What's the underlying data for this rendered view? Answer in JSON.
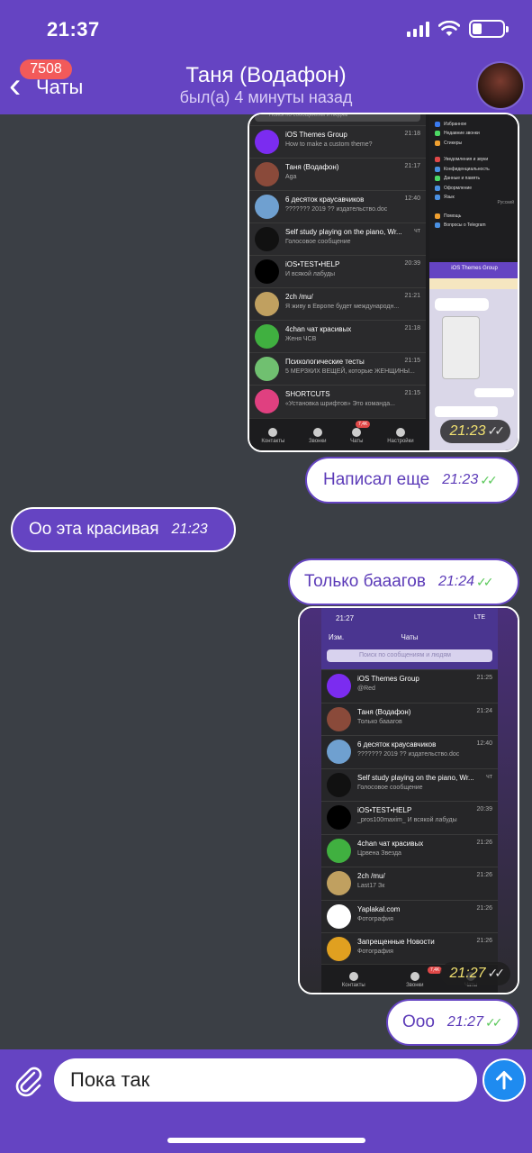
{
  "status_bar": {
    "time": "21:37"
  },
  "header": {
    "back_label": "Чаты",
    "unread_badge": "7508",
    "contact_name": "Таня (Водафон)",
    "last_seen": "был(а) 4 минуты назад"
  },
  "messages": [
    {
      "id": "m1",
      "direction": "out",
      "type": "image",
      "time": "21:23",
      "read": true
    },
    {
      "id": "m2",
      "direction": "out",
      "type": "text",
      "text": "Написал еще",
      "time": "21:23",
      "read": true
    },
    {
      "id": "m3",
      "direction": "in",
      "type": "text",
      "text": "Оо эта красивая",
      "time": "21:23"
    },
    {
      "id": "m4",
      "direction": "out",
      "type": "text",
      "text": "Только бааагов",
      "time": "21:24",
      "read": true
    },
    {
      "id": "m5",
      "direction": "out",
      "type": "image",
      "time": "21:27",
      "read": true
    },
    {
      "id": "m6",
      "direction": "out",
      "type": "text",
      "text": "Ооо",
      "time": "21:27",
      "read": true
    }
  ],
  "screenshot1": {
    "search_placeholder": "Поиск по сообщениям и людям",
    "chats": [
      {
        "name": "iOS Themes Group",
        "sub": "How to make a custom theme?",
        "time": "21:18",
        "color": "#7b2cf0"
      },
      {
        "name": "Таня (Водафон)",
        "sub": "Aga",
        "time": "21:17",
        "color": "#8a4a3a"
      },
      {
        "name": "6 десяток краусавчиков",
        "sub": "??????? 2019 ?? издательство.doc",
        "time": "12:40",
        "color": "#6fa0d0"
      },
      {
        "name": "Self study playing on the piano, Wr...",
        "sub": "Голосовое сообщение",
        "time": "чт",
        "color": "#111111"
      },
      {
        "name": "iOS•TEST•HELP",
        "sub": "И всякой лабуды",
        "time": "20:39",
        "color": "#000000"
      },
      {
        "name": "2ch /mu/",
        "sub": "Я живу в Европе будет международн...",
        "time": "21:21",
        "color": "#c0a060"
      },
      {
        "name": "4chan чат красивых",
        "sub": "Женя ЧСВ",
        "time": "21:18",
        "color": "#40b040"
      },
      {
        "name": "Психологические тесты",
        "sub": "5 МЕРЗКИХ ВЕЩЕЙ, которые ЖЕНЩИНЫ...",
        "time": "21:15",
        "color": "#70c070"
      },
      {
        "name": "SHORTCUTS",
        "sub": "«Установка шрифтов» Это команда...",
        "time": "21:15",
        "color": "#e04080"
      }
    ],
    "tabs": [
      "Контакты",
      "Звонки",
      "Чаты",
      "Настройки"
    ],
    "tab_badge": "7,4K",
    "settings": [
      "Избранное",
      "Недавние звонки",
      "Стикеры",
      "Уведомления и звуки",
      "Конфиденциальность",
      "Данные и память",
      "Оформление",
      "Язык",
      "Помощь",
      "Вопросы о Telegram"
    ],
    "settings_value": "Русский",
    "preview_title": "iOS Themes Group"
  },
  "screenshot2": {
    "time": "21:27",
    "network": "LTE",
    "edit_label": "Изм.",
    "title": "Чаты",
    "search_placeholder": "Поиск по сообщениям и людям",
    "chats": [
      {
        "name": "iOS Themes Group",
        "sub": "@Red",
        "time": "21:25",
        "color": "#7b2cf0"
      },
      {
        "name": "Таня (Водафон)",
        "sub": "Только бааагов",
        "time": "21:24",
        "color": "#8a4a3a"
      },
      {
        "name": "6 десяток краусавчиков",
        "sub": "??????? 2019 ?? издательство.doc",
        "time": "12:40",
        "color": "#6fa0d0"
      },
      {
        "name": "Self study playing on the piano, Wr...",
        "sub": "Голосовое сообщение",
        "time": "чт",
        "color": "#111111"
      },
      {
        "name": "iOS•TEST•HELP",
        "sub": "_pros100maxim_ И всякой лабуды",
        "time": "20:39",
        "color": "#000000"
      },
      {
        "name": "4chan чат красивых",
        "sub": "Црвена Звезда",
        "time": "21:26",
        "color": "#40b040"
      },
      {
        "name": "2ch /mu/",
        "sub": "Last17 Зк",
        "time": "21:26",
        "color": "#c0a060"
      },
      {
        "name": "Yaplakal.com",
        "sub": "Фотография",
        "time": "21:26",
        "color": "#ffffff"
      },
      {
        "name": "Запрещенные Новости",
        "sub": "Фотография",
        "time": "21:26",
        "color": "#e0a020"
      }
    ],
    "tabs": [
      "Контакты",
      "Звонки",
      "Чаты"
    ],
    "tab_badge": "7,4K"
  },
  "composer": {
    "text": "Пока так"
  }
}
